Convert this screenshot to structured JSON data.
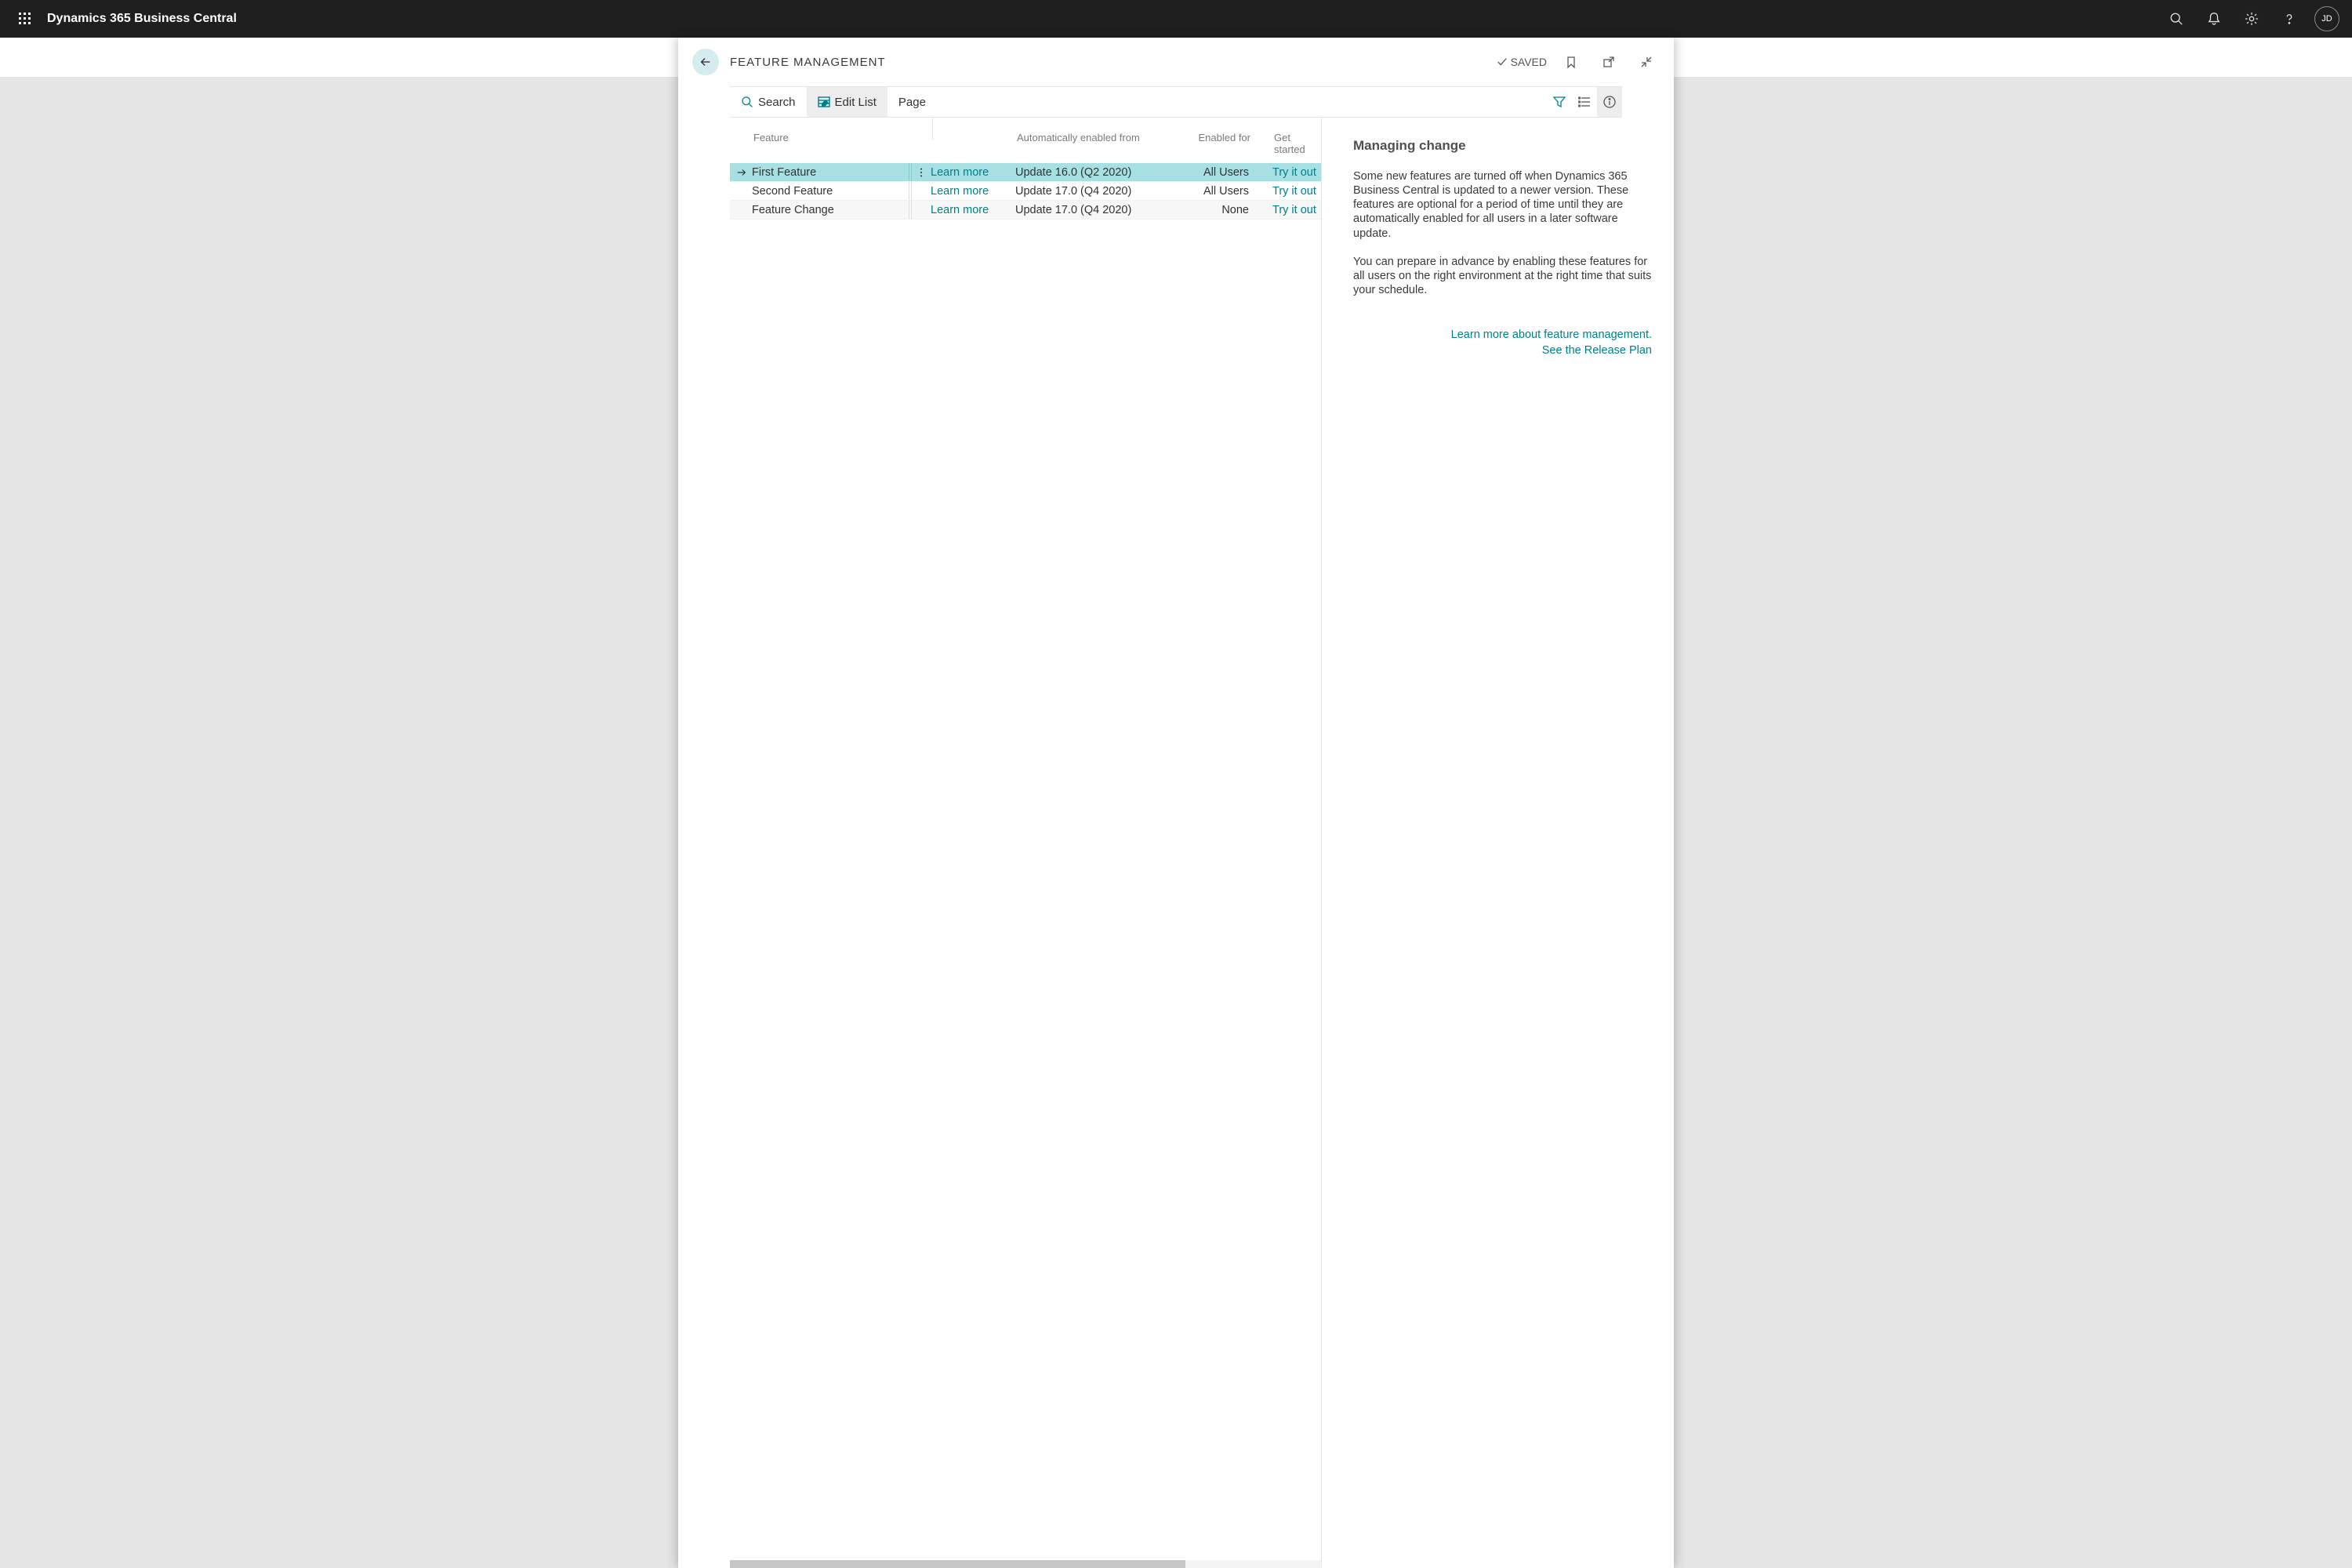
{
  "app": {
    "title": "Dynamics 365 Business Central",
    "user_initials": "JD"
  },
  "page": {
    "title": "FEATURE MANAGEMENT",
    "saved_label": "SAVED"
  },
  "toolbar": {
    "search_label": "Search",
    "edit_list_label": "Edit List",
    "page_label": "Page"
  },
  "columns": {
    "feature": "Feature",
    "auto_enabled": "Automatically enabled from",
    "enabled_for": "Enabled for",
    "get_started": "Get started"
  },
  "rows": [
    {
      "feature": "First Feature",
      "learn": "Learn more",
      "auto": "Update 16.0 (Q2 2020)",
      "enabled": "All Users",
      "get": "Try it out",
      "selected": true
    },
    {
      "feature": "Second Feature",
      "learn": "Learn more",
      "auto": "Update 17.0 (Q4 2020)",
      "enabled": "All Users",
      "get": "Try it out",
      "selected": false
    },
    {
      "feature": "Feature Change",
      "learn": "Learn more",
      "auto": "Update 17.0 (Q4 2020)",
      "enabled": "None",
      "get": "Try it out",
      "selected": false
    }
  ],
  "factbox": {
    "title": "Managing change",
    "p1": "Some new features are turned off when Dynamics 365 Business Central is updated to a newer version. These features are optional for a period of time until they are automatically enabled for all users in a later software update.",
    "p2": "You can prepare in advance by enabling these features for all users on the right environment at the right time that suits your schedule.",
    "link1": "Learn more about feature management.",
    "link2": "See the Release Plan"
  }
}
